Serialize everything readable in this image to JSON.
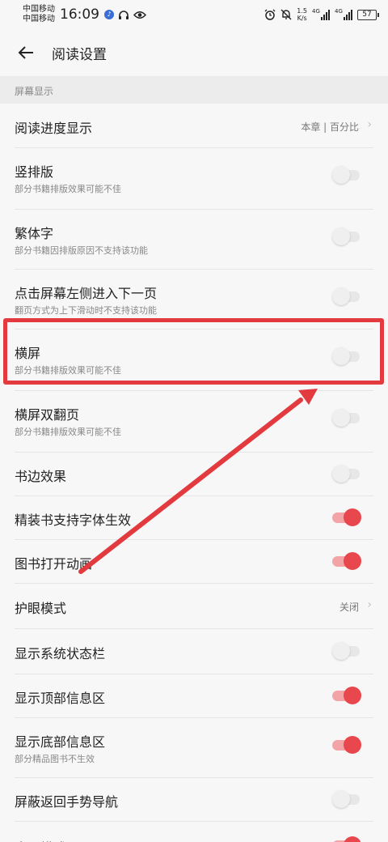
{
  "status_bar": {
    "carrier_1": "中国移动",
    "carrier_2": "中国移动",
    "time": "16:09",
    "speed_value": "1.5",
    "speed_unit": "K/s",
    "signal_tag_1": "4G",
    "signal_tag_2": "4G",
    "battery": "57"
  },
  "header": {
    "title": "阅读设置"
  },
  "section": {
    "label": "屏幕显示"
  },
  "rows": [
    {
      "title": "阅读进度显示",
      "value": "本章 | 百分比",
      "type": "link"
    },
    {
      "title": "竖排版",
      "subtitle": "部分书籍排版效果可能不佳",
      "type": "toggle",
      "on": false
    },
    {
      "title": "繁体字",
      "subtitle": "部分书籍因排版原因不支持该功能",
      "type": "toggle",
      "on": false
    },
    {
      "title": "点击屏幕左侧进入下一页",
      "subtitle": "翻页方式为上下滑动时不支持该功能",
      "type": "toggle",
      "on": false
    },
    {
      "title": "横屏",
      "subtitle": "部分书籍排版效果可能不佳",
      "type": "toggle",
      "on": false
    },
    {
      "title": "横屏双翻页",
      "subtitle": "部分书籍排版效果可能不佳",
      "type": "toggle",
      "on": false
    },
    {
      "title": "书边效果",
      "type": "toggle",
      "on": false
    },
    {
      "title": "精装书支持字体生效",
      "type": "toggle",
      "on": true
    },
    {
      "title": "图书打开动画",
      "type": "toggle",
      "on": true
    },
    {
      "title": "护眼模式",
      "value": "关闭",
      "type": "link"
    },
    {
      "title": "显示系统状态栏",
      "type": "toggle",
      "on": false
    },
    {
      "title": "显示顶部信息区",
      "type": "toggle",
      "on": true
    },
    {
      "title": "显示底部信息区",
      "subtitle": "部分精品图书不生效",
      "type": "toggle",
      "on": true
    },
    {
      "title": "屏蔽返回手势导航",
      "type": "toggle",
      "on": false
    },
    {
      "title": "全屏模式",
      "type": "toggle",
      "on": true
    }
  ],
  "colors": {
    "accent": "#e8474d",
    "annotation": "#e23a3f"
  }
}
